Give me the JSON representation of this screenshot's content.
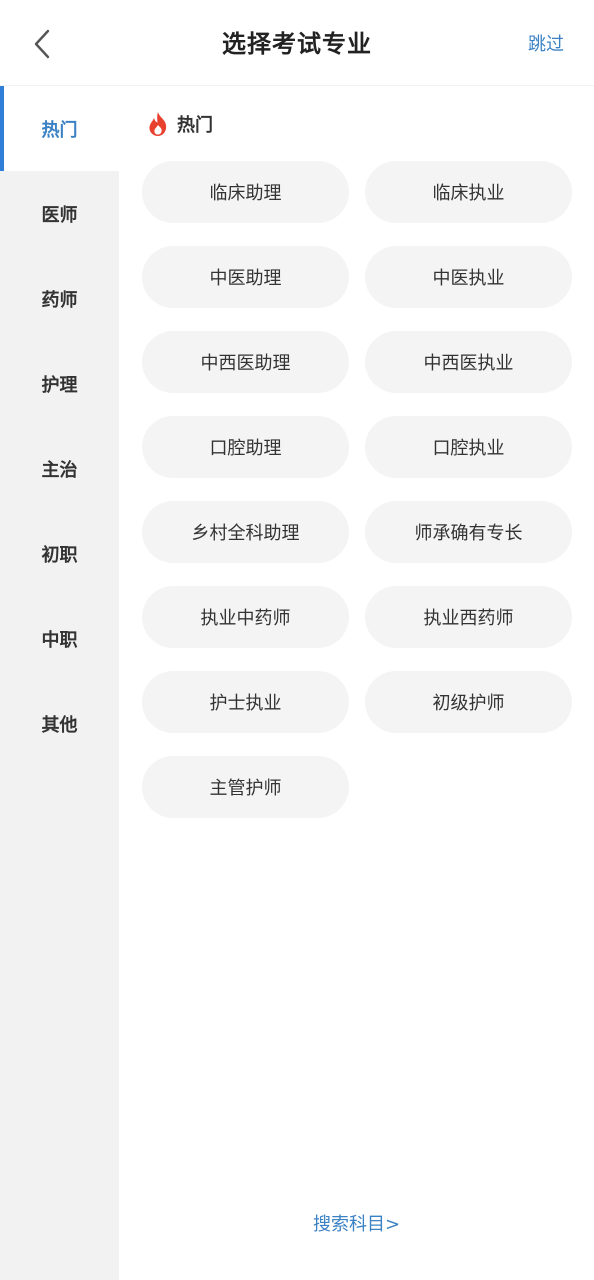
{
  "header": {
    "title": "选择考试专业",
    "skip_label": "跳过"
  },
  "sidebar": {
    "items": [
      {
        "label": "热门",
        "active": true
      },
      {
        "label": "医师",
        "active": false
      },
      {
        "label": "药师",
        "active": false
      },
      {
        "label": "护理",
        "active": false
      },
      {
        "label": "主治",
        "active": false
      },
      {
        "label": "初职",
        "active": false
      },
      {
        "label": "中职",
        "active": false
      },
      {
        "label": "其他",
        "active": false
      }
    ]
  },
  "main": {
    "section_title": "热门",
    "section_icon": "flame-icon",
    "options": [
      "临床助理",
      "临床执业",
      "中医助理",
      "中医执业",
      "中西医助理",
      "中西医执业",
      "口腔助理",
      "口腔执业",
      "乡村全科助理",
      "师承确有专长",
      "执业中药师",
      "执业西药师",
      "护士执业",
      "初级护师",
      "主管护师"
    ],
    "search_link": "搜索科目>"
  },
  "colors": {
    "accent": "#3b82c4",
    "active_bar": "#2f7fd8",
    "sidebar_bg": "#f2f2f2",
    "chip_bg": "#f4f4f4",
    "flame": "#e8412e"
  }
}
